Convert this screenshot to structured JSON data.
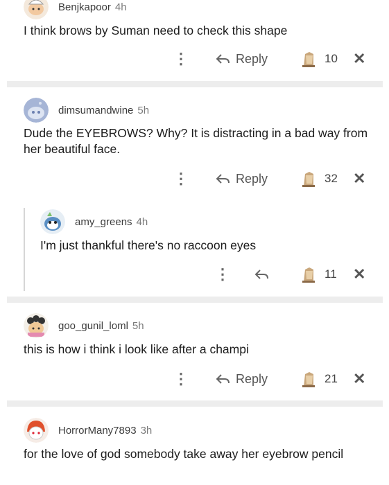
{
  "comments": [
    {
      "user": "Benjkapoor",
      "age": "4h",
      "text": "I think brows by Suman need to check this shape",
      "reply_label": "Reply",
      "count": "10",
      "avatar_icon": "snoo-avatar-chef-icon"
    },
    {
      "user": "dimsumandwine",
      "age": "5h",
      "text": "Dude the EYEBROWS? Why? It is distracting in a bad way from her beautiful face.",
      "reply_label": "Reply",
      "count": "32",
      "avatar_icon": "default-snoo-avatar-icon"
    },
    {
      "user": "amy_greens",
      "age": "4h",
      "text": "I'm just thankful there's no raccoon eyes",
      "reply_label": "",
      "count": "11",
      "avatar_icon": "snoo-avatar-blue-icon"
    },
    {
      "user": "goo_gunil_loml",
      "age": "5h",
      "text": "this is how i think i look like after a champi",
      "reply_label": "Reply",
      "count": "21",
      "avatar_icon": "snoo-avatar-curly-icon"
    },
    {
      "user": "HorrorMany7893",
      "age": "3h",
      "text": "for the love of god somebody take away her eyebrow pencil",
      "reply_label": "",
      "count": "",
      "avatar_icon": "snoo-avatar-red-hair-icon"
    }
  ],
  "glyphs": {
    "more": "⋮",
    "close": "✕"
  },
  "colors": {
    "divider": "#ededed",
    "text": "#1c1c1c",
    "muted": "#7a7a7a"
  }
}
